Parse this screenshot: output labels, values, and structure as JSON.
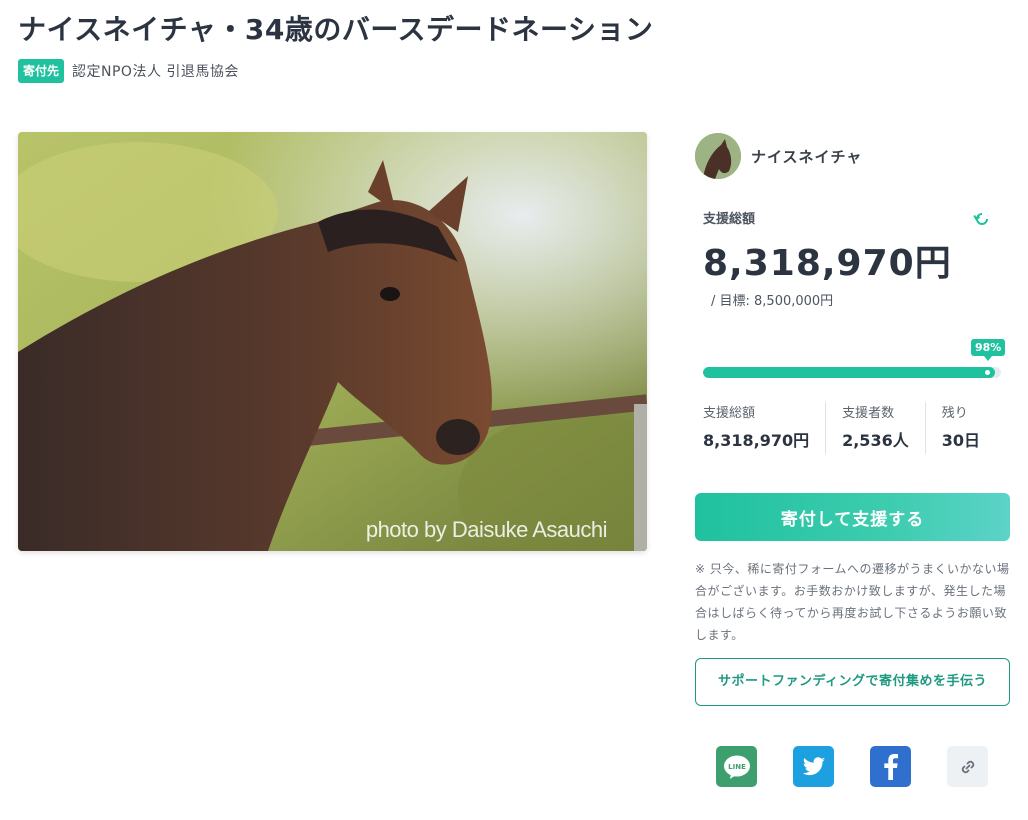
{
  "page": {
    "title": "ナイスネイチャ・34歳のバースデードネーション",
    "badge": "寄付先",
    "organization": "認定NPO法人 引退馬協会"
  },
  "photo": {
    "credit": "photo by Daisuke Asauchi"
  },
  "owner": {
    "name": "ナイスネイチャ"
  },
  "funding": {
    "total_label": "支援総額",
    "total_amount": "8,318,970円",
    "target_text": "/ 目標: 8,500,000円",
    "progress_percent": 98,
    "progress_label": "98%",
    "stats": [
      {
        "label": "支援総額",
        "value": "8,318,970円"
      },
      {
        "label": "支援者数",
        "value": "2,536人"
      },
      {
        "label": "残り",
        "value": "30日"
      }
    ]
  },
  "actions": {
    "donate_label": "寄付して支援する",
    "note": "※ 只今、稀に寄付フォームへの遷移がうまくいかない場合がございます。お手数おかけ致しますが、発生した場合はしばらく待ってから再度お試し下さるようお願い致します。",
    "support_label": "サポートファンディングで寄付集めを手伝う"
  },
  "share": {
    "line_text": "LINE",
    "icons": [
      "line-icon",
      "twitter-icon",
      "facebook-icon",
      "link-icon"
    ]
  },
  "colors": {
    "accent": "#1fc19f",
    "text": "#2b3440",
    "line": "#3d9f6e",
    "twitter": "#1da0e0",
    "facebook": "#2f6fcd"
  }
}
